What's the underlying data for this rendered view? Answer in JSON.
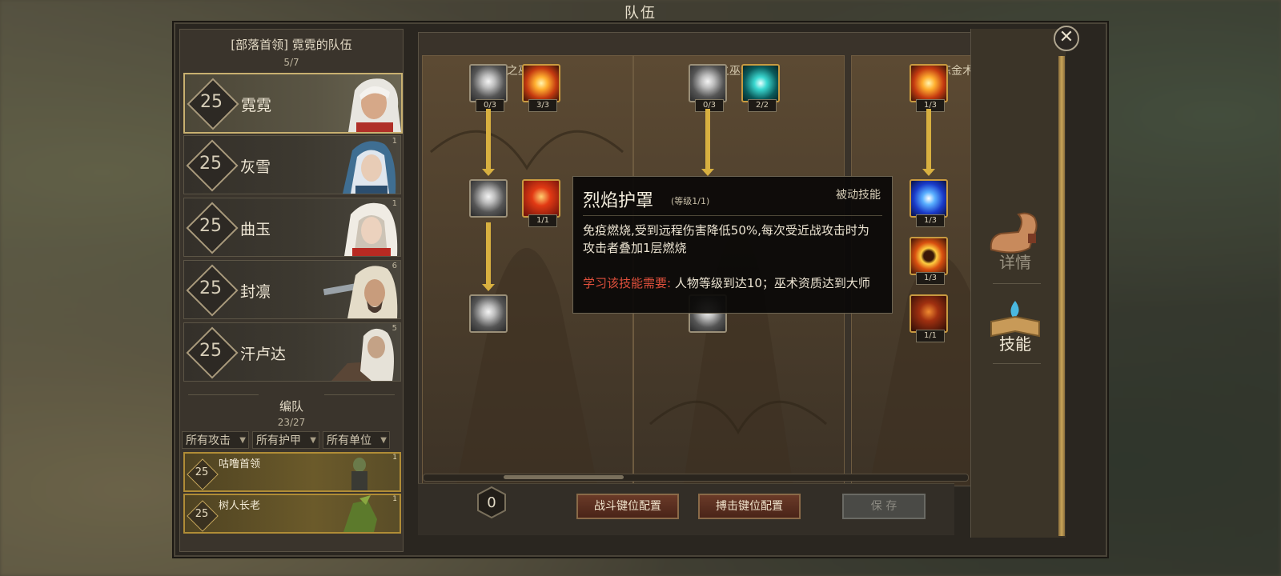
{
  "window_title": "队伍",
  "team": {
    "title": "[部落首领] 霓霓的队伍",
    "count": "5/7",
    "members": [
      {
        "level": "25",
        "name": "霓霓",
        "corner": ""
      },
      {
        "level": "25",
        "name": "灰雪",
        "corner": "1"
      },
      {
        "level": "25",
        "name": "曲玉",
        "corner": "1"
      },
      {
        "level": "25",
        "name": "封凛",
        "corner": "6"
      },
      {
        "level": "25",
        "name": "汗卢达",
        "corner": "5"
      }
    ]
  },
  "formation": {
    "title": "编队",
    "count": "23/27",
    "filters": [
      "所有攻击",
      "所有护甲",
      "所有单位"
    ],
    "units": [
      {
        "level": "25",
        "name": "咕噜首领",
        "corner": "1"
      },
      {
        "level": "25",
        "name": "树人长老",
        "corner": "1"
      }
    ]
  },
  "skill_trees": {
    "columns": [
      "火之巫术 (4)",
      "雷之巫术 (3)",
      "炼金术"
    ],
    "badges": {
      "fire_r1a": "0/3",
      "fire_r1b": "3/3",
      "fire_r2b": "1/1",
      "thunder_r1a": "0/3",
      "thunder_r1b": "2/2",
      "alch_r1": "1/3",
      "alch_r2": "1/3",
      "alch_r3": "1/3",
      "alch_r4": "1/1"
    }
  },
  "tooltip": {
    "name": "烈焰护罩",
    "level": "(等级1/1)",
    "type": "被动技能",
    "description": "免疫燃烧,受到远程伤害降低50%,每次受近战攻击时为攻击者叠加1层燃烧",
    "requirement_label": "学习该技能需要:",
    "requirement_text": "人物等级到达10；巫术资质达到大师"
  },
  "bottom": {
    "points": "0",
    "battle_keys": "战斗键位配置",
    "grapple_keys": "搏击键位配置",
    "save": "保 存"
  },
  "side_tabs": {
    "details": "详情",
    "skills": "技能"
  },
  "close_icon": "close-icon"
}
